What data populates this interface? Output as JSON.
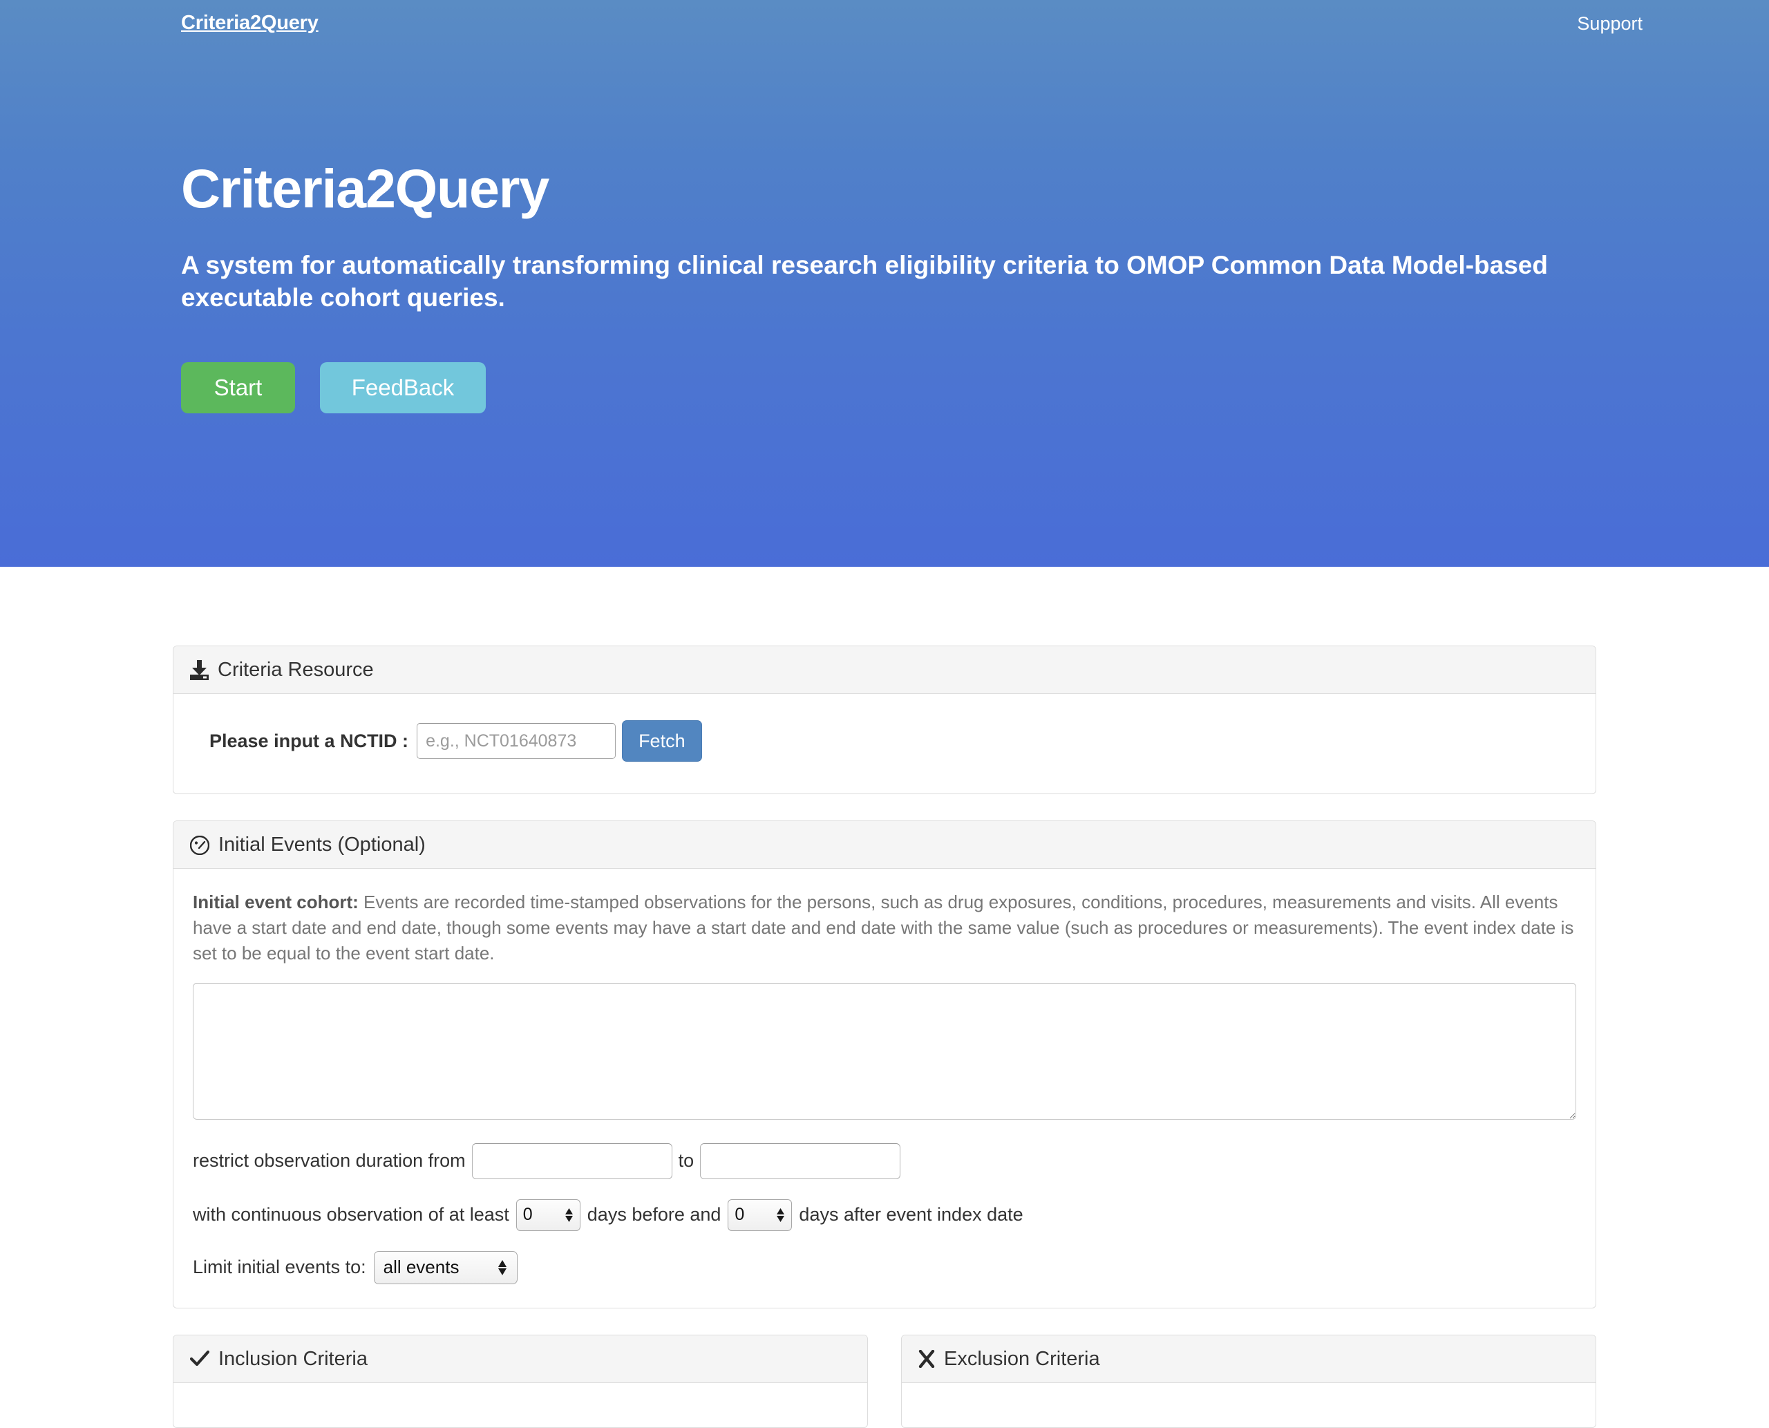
{
  "navbar": {
    "brand": "Criteria2Query",
    "support_label": "Support"
  },
  "hero": {
    "title": "Criteria2Query",
    "subtitle": "A system for automatically transforming clinical research eligibility criteria to OMOP Common Data Model-based executable cohort queries.",
    "start_label": "Start",
    "feedback_label": "FeedBack",
    "start_color": "#5cb85c",
    "feedback_color": "#72c7dc",
    "gradient_top": "#5a8cc4",
    "gradient_bottom": "#4a6dd7"
  },
  "criteria_resource": {
    "icon": "download-icon",
    "title": "Criteria Resource",
    "nctid_label": "Please input a NCTID :",
    "nctid_value": "",
    "nctid_placeholder": "e.g., NCT01640873",
    "fetch_label": "Fetch",
    "fetch_color": "#5286c0"
  },
  "initial_events": {
    "icon": "dashboard-icon",
    "title": "Initial Events (Optional)",
    "desc_bold": "Initial event cohort:",
    "desc_text": " Events are recorded time-stamped observations for the persons, such as drug exposures, conditions, procedures, measurements and visits. All events have a start date and end date, though some events may have a start date and end date with the same value (such as procedures or measurements). The event index date is set to be equal to the event start date.",
    "cohort_textarea_value": "",
    "restrict_prefix": "restrict observation duration from",
    "restrict_from_value": "",
    "restrict_to_label": "to",
    "restrict_to_value": "",
    "continuous_prefix": "with continuous observation of at least",
    "days_before_value": "0",
    "days_before_label": "days before and",
    "days_after_value": "0",
    "days_after_label": "days after event index date",
    "limit_label": "Limit initial events to:",
    "limit_value": "all events"
  },
  "inclusion_criteria": {
    "icon": "check-icon",
    "title": "Inclusion Criteria"
  },
  "exclusion_criteria": {
    "icon": "x-icon",
    "title": "Exclusion Criteria"
  }
}
